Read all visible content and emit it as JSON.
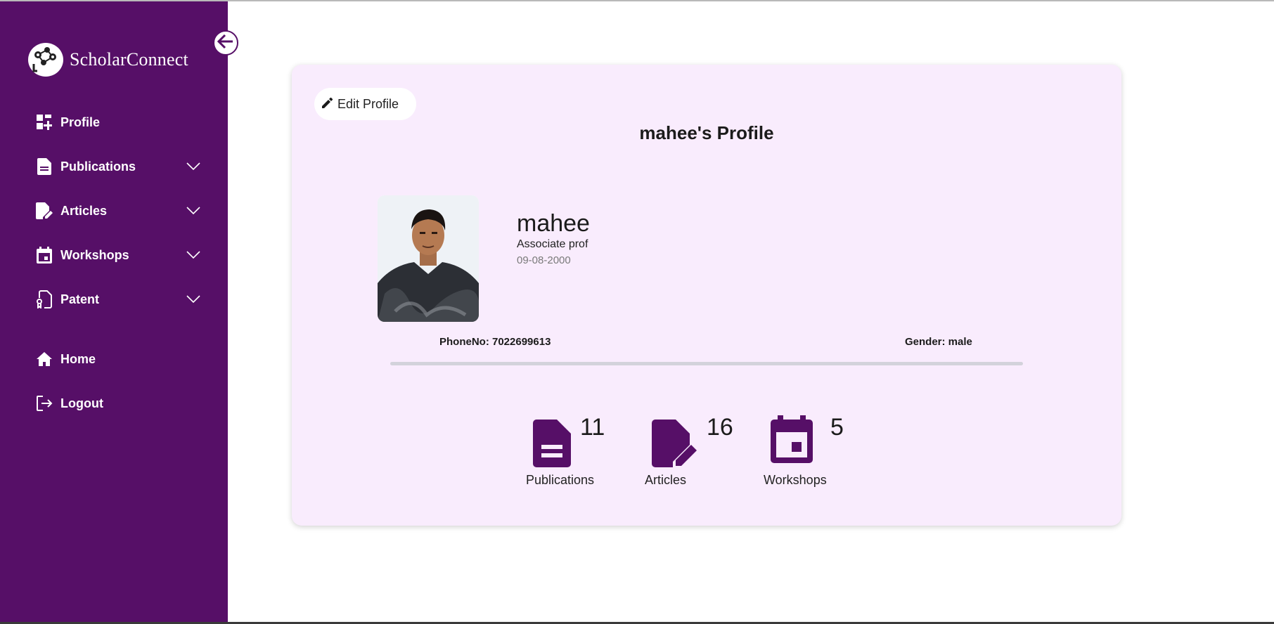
{
  "app": {
    "name": "ScholarConnect"
  },
  "sidebar": {
    "items": [
      {
        "label": "Profile",
        "icon": "dashboard-icon",
        "expandable": false
      },
      {
        "label": "Publications",
        "icon": "document-icon",
        "expandable": true
      },
      {
        "label": "Articles",
        "icon": "edit-document-icon",
        "expandable": true
      },
      {
        "label": "Workshops",
        "icon": "calendar-icon",
        "expandable": true
      },
      {
        "label": "Patent",
        "icon": "patent-icon",
        "expandable": true
      },
      {
        "label": "Home",
        "icon": "home-icon",
        "expandable": false
      },
      {
        "label": "Logout",
        "icon": "logout-icon",
        "expandable": false
      }
    ]
  },
  "profile": {
    "edit_label": "Edit Profile",
    "title": "mahee's Profile",
    "name": "mahee",
    "role": "Associate prof",
    "dob": "09-08-2000",
    "phone": "PhoneNo: 7022699613",
    "gender": "Gender: male"
  },
  "stats": [
    {
      "label": "Publications",
      "count": "11",
      "icon": "document-icon"
    },
    {
      "label": "Articles",
      "count": "16",
      "icon": "edit-document-icon"
    },
    {
      "label": "Workshops",
      "count": "5",
      "icon": "calendar-icon"
    }
  ],
  "colors": {
    "sidebar": "#560f67",
    "card": "#f9ecfd",
    "accent": "#560f67",
    "divider": "#d3d2db"
  }
}
